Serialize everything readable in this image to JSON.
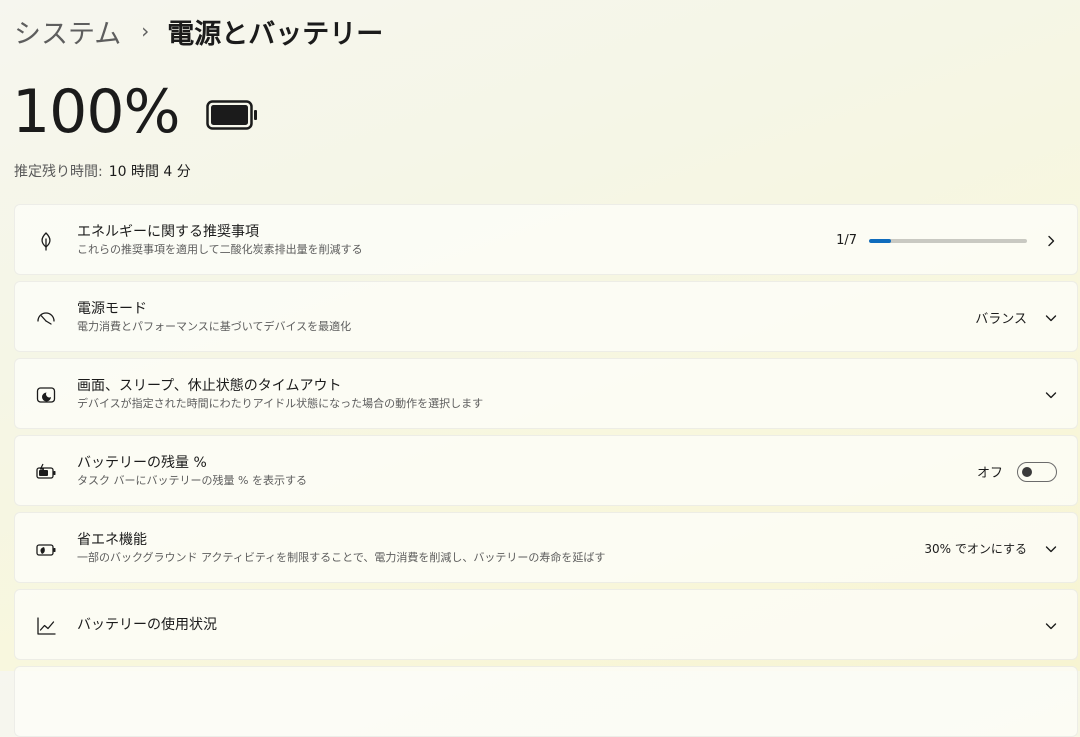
{
  "breadcrumb": {
    "parent": "システム",
    "separator": "›",
    "current": "電源とバッテリー"
  },
  "battery": {
    "percent": "100%",
    "level": 1.0
  },
  "estimate": {
    "label": "推定残り時間:",
    "value": "10 時間 4 分"
  },
  "cards": {
    "energy": {
      "title": "エネルギーに関する推奨事項",
      "desc": "これらの推奨事項を適用して二酸化炭素排出量を削減する",
      "count": "1/7",
      "progress": 0.14
    },
    "power_mode": {
      "title": "電源モード",
      "desc": "電力消費とパフォーマンスに基づいてデバイスを最適化",
      "value": "バランス"
    },
    "screen_sleep": {
      "title": "画面、スリープ、休止状態のタイムアウト",
      "desc": "デバイスが指定された時間にわたりアイドル状態になった場合の動作を選択します"
    },
    "battery_percent": {
      "title": "バッテリーの残量 %",
      "desc": "タスク バーにバッテリーの残量 % を表示する",
      "toggle_label": "オフ",
      "toggle_on": false
    },
    "energy_saver": {
      "title": "省エネ機能",
      "desc": "一部のバックグラウンド アクティビティを制限することで、電力消費を削減し、バッテリーの寿命を延ばす",
      "value": "30% でオンにする"
    },
    "battery_usage": {
      "title": "バッテリーの使用状況"
    }
  },
  "colors": {
    "accent": "#0f6cbd"
  }
}
